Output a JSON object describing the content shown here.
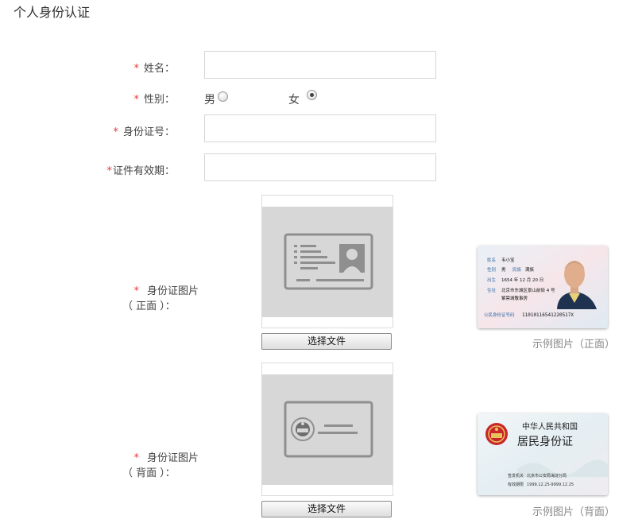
{
  "page": {
    "title": "个人身份认证"
  },
  "form": {
    "required_mark": "*",
    "name_label": "姓名：",
    "gender_label": "性别：",
    "gender_options": [
      {
        "label": "男",
        "checked": false
      },
      {
        "label": "女",
        "checked": true
      }
    ],
    "id_number_label": "身份证号：",
    "validity_label": "证件有效期：",
    "front_label_line1": "身份证图片",
    "front_label_line2": "（ 正面 ）：",
    "back_label_line1": "身份证图片",
    "back_label_line2": "（ 背面 ）：",
    "choose_file_label": "选择文件"
  },
  "samples": {
    "front_caption": "示例图片（正面）",
    "back_caption": "示例图片（背面）",
    "front_card": {
      "name": "韦小宝",
      "sex": "男",
      "ethnicity": "满族",
      "birth": "1654 年 12 月 20 日",
      "address_line1": "北京市东城区景山前街 4 号",
      "address_line2": "紫禁城敬事房",
      "id_label": "公民身份证号码",
      "id_number": "11010116541220517X",
      "field_name": "姓名",
      "field_sex": "性别",
      "field_ethnic": "民族",
      "field_birth": "出生",
      "field_address": "住址"
    },
    "back_card": {
      "title1": "中华人民共和国",
      "title2": "居民身份证",
      "authority_label": "签发机关",
      "authority": "北京市公安局海淀分局",
      "validity_label": "有效期限",
      "validity": "1999.12.25-9999.12.25"
    }
  },
  "colors": {
    "required": "#e23b3b",
    "placeholder_bg": "#d7d7d7",
    "placeholder_icon": "#8f8f8f"
  }
}
